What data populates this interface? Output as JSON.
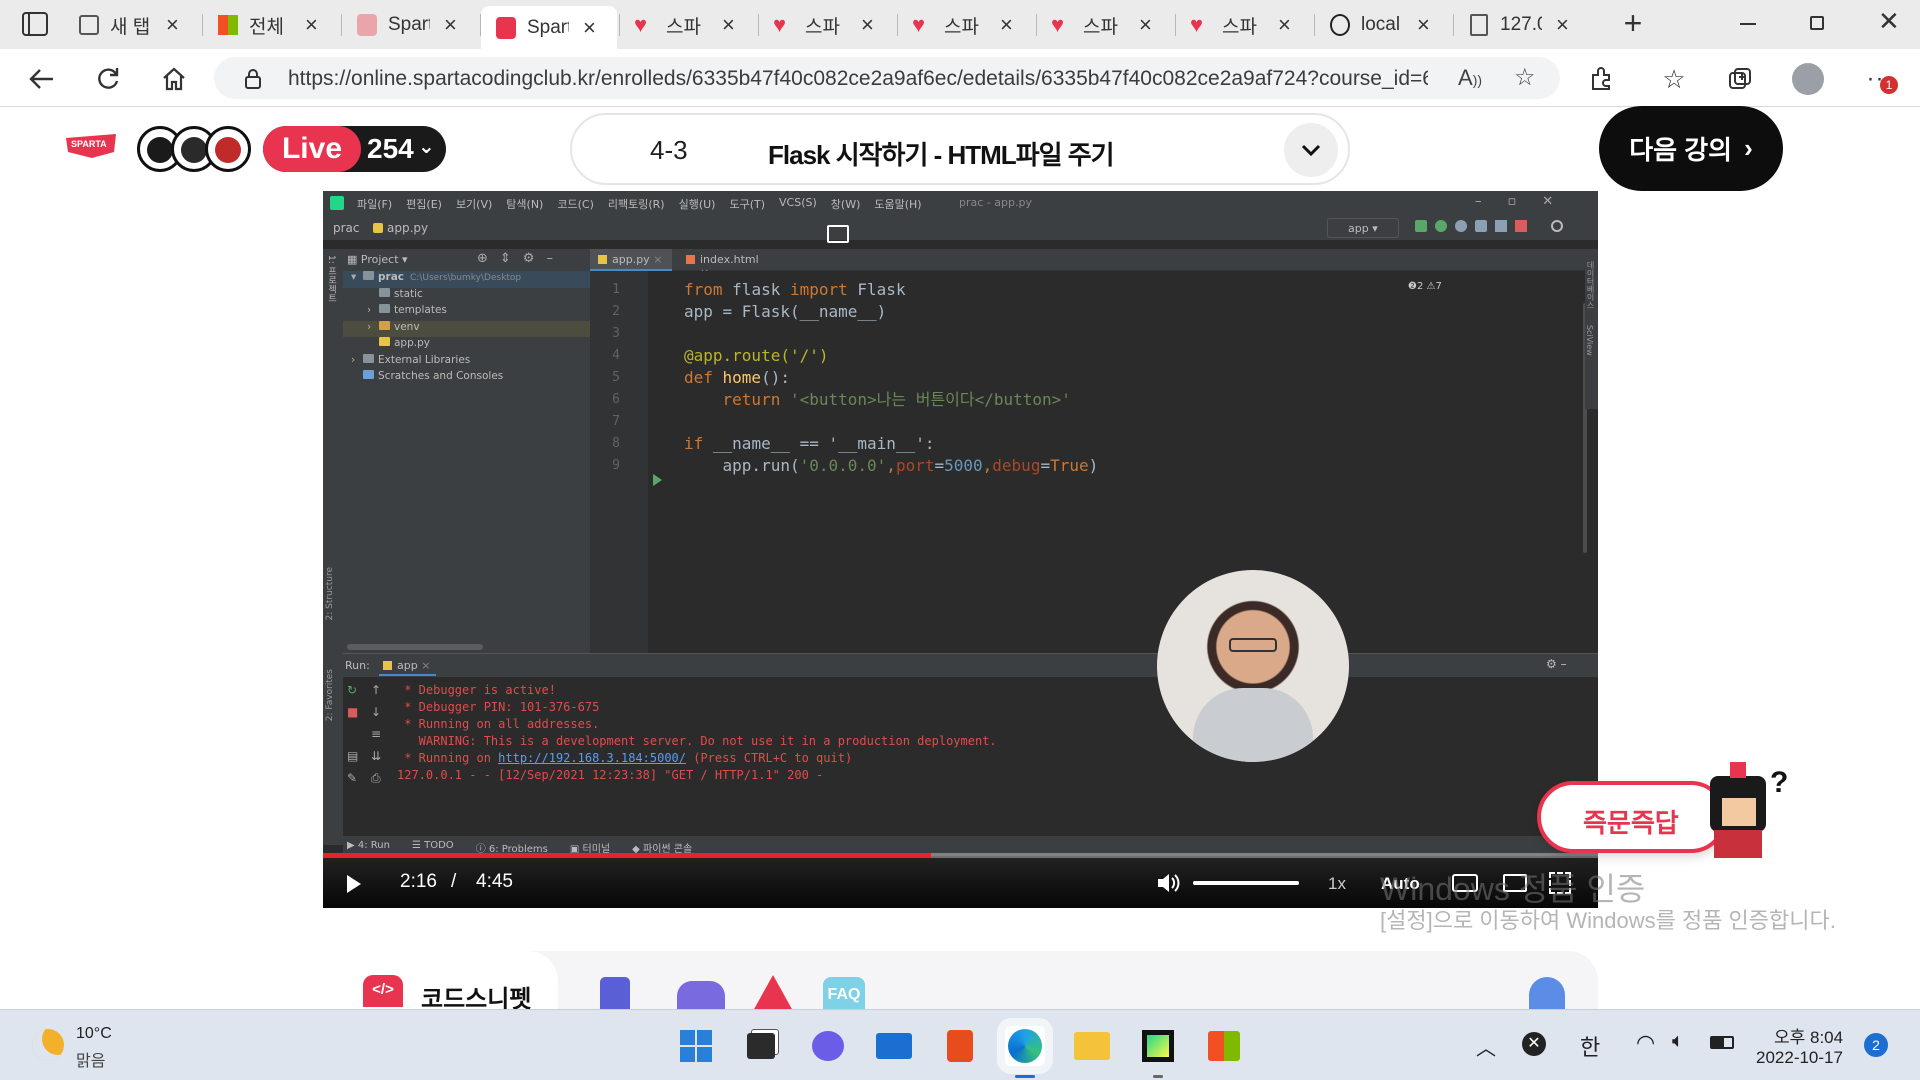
{
  "browser": {
    "tabs": [
      {
        "title": "새 탭",
        "kind": "newtab"
      },
      {
        "title": "전체",
        "kind": "ms"
      },
      {
        "title": "Spart",
        "kind": "sparta-dim"
      },
      {
        "title": "Spart",
        "kind": "sparta",
        "active": true
      },
      {
        "title": "스파",
        "kind": "heart"
      },
      {
        "title": "스파",
        "kind": "heart"
      },
      {
        "title": "스파",
        "kind": "heart"
      },
      {
        "title": "스파",
        "kind": "heart"
      },
      {
        "title": "스파",
        "kind": "heart"
      },
      {
        "title": "local",
        "kind": "local"
      },
      {
        "title": "127.0",
        "kind": "doc"
      }
    ],
    "url": "https://online.spartacodingclub.kr/enrolleds/6335b47f40c082ce2a9af6ec/edetails/6335b47f40c082ce2a9af724?course_id=6...",
    "notification_count": "1"
  },
  "header": {
    "logo": "SPARTA",
    "live_label": "Live",
    "viewer_count": "254",
    "lecture_number": "4-3",
    "lecture_title": "Flask 시작하기 - HTML파일 주기",
    "next_button": "다음 강의"
  },
  "ide": {
    "menu": [
      "파일(F)",
      "편집(E)",
      "보기(V)",
      "탐색(N)",
      "코드(C)",
      "리팩토링(R)",
      "실행(U)",
      "도구(T)",
      "VCS(S)",
      "창(W)",
      "도움말(H)"
    ],
    "window_title": "prac - app.py",
    "breadcrumb": [
      "prac",
      "app.py"
    ],
    "run_config": "app",
    "project_label": "Project",
    "tree": [
      {
        "label": "prac",
        "extra": "C:\\Users\\bumky\\Desktop",
        "level": 0,
        "arrow": "▾",
        "kind": "folder"
      },
      {
        "label": "static",
        "level": 1,
        "arrow": "",
        "kind": "folder"
      },
      {
        "label": "templates",
        "level": 1,
        "arrow": "›",
        "kind": "folder"
      },
      {
        "label": "venv",
        "level": 1,
        "arrow": "›",
        "kind": "folder-orange"
      },
      {
        "label": "app.py",
        "level": 1,
        "arrow": "",
        "kind": "py"
      },
      {
        "label": "External Libraries",
        "level": 0,
        "arrow": "›",
        "kind": "lib"
      },
      {
        "label": "Scratches and Consoles",
        "level": 0,
        "arrow": "",
        "kind": "scratch"
      }
    ],
    "editor_tabs": [
      "app.py",
      "index.html"
    ],
    "inspections": "❷2 ⚠7",
    "line_numbers": [
      "1",
      "2",
      "3",
      "4",
      "5",
      "6",
      "7",
      "8",
      "9"
    ],
    "code": [
      [
        [
          "from ",
          "kw"
        ],
        [
          "flask ",
          "id"
        ],
        [
          "import ",
          "kw"
        ],
        [
          "Flask",
          "id"
        ]
      ],
      [
        [
          "app = Flask(__name__)",
          "id"
        ]
      ],
      [],
      [
        [
          "@app.route('/')",
          "dec"
        ]
      ],
      [
        [
          "def ",
          "kw"
        ],
        [
          "home",
          "fn"
        ],
        [
          "():",
          "id"
        ]
      ],
      [
        [
          "    ",
          "id"
        ],
        [
          "return ",
          "kw"
        ],
        [
          "'<button>나는 버튼이다</button>'",
          "str"
        ]
      ],
      [],
      [
        [
          "if ",
          "kw"
        ],
        [
          "__name__ == '__main__':",
          "id"
        ]
      ],
      [
        [
          "    app.run(",
          "id"
        ],
        [
          "'0.0.0.0'",
          "str"
        ],
        [
          ",",
          "kw"
        ],
        [
          "port",
          "param"
        ],
        [
          "=",
          "id"
        ],
        [
          "5000",
          "num"
        ],
        [
          ",",
          "kw"
        ],
        [
          "debug",
          "param"
        ],
        [
          "=",
          "id"
        ],
        [
          "True",
          "kw"
        ],
        [
          ")",
          "id"
        ]
      ]
    ],
    "run_label": "Run:",
    "run_tab": "app",
    "console": [
      {
        "text": " * Debugger is active!",
        "color": "#e34b4b"
      },
      {
        "text": " * Debugger PIN: 101-376-675",
        "color": "#e34b4b"
      },
      {
        "text": " * Running on all addresses.",
        "color": "#e34b4b"
      },
      {
        "text": "   WARNING: This is a development server. Do not use it in a production deployment.",
        "color": "#e34b4b"
      },
      {
        "text": " * Running on ",
        "color": "#e34b4b",
        "link": "http://192.168.3.184:5000/",
        "after": " (Press CTRL+C to quit)"
      },
      {
        "text": "127.0.0.1 - - [12/Sep/2021 12:23:38] \"GET / HTTP/1.1\" 200 -",
        "color": "#e34b4b"
      }
    ],
    "bottom_tools": [
      "4: Run",
      "TODO",
      "6: Problems",
      "터미널",
      "파이썬 콘솔"
    ],
    "side_labels": {
      "project": "1: 프로젝트",
      "structure": "2: Structure",
      "favorites": "2: Favorites",
      "right": "데이터베이스",
      "sciview": "SciView"
    }
  },
  "player": {
    "current": "2:16",
    "separator": "/",
    "duration": "4:45",
    "speed": "1x",
    "quality": "Auto",
    "progress_fraction": 0.477,
    "volume_fraction": 1.0
  },
  "overlay": {
    "quick_answer": "즉문즉답",
    "watermark_title": "Windows 정품 인증",
    "watermark_text": "[설정]으로 이동하여 Windows를 정품 인증합니다."
  },
  "bottom_tabs": {
    "first": "코드스니펫",
    "faq": "FAQ"
  },
  "taskbar": {
    "temperature": "10°C",
    "weather": "맑음",
    "ime": "한",
    "ampm_time": "오후 8:04",
    "date": "2022-10-17",
    "notifications": "2"
  },
  "colors": {
    "brand_red": "#e8344e",
    "live_red": "#e8344e",
    "ide_bg": "#2b2b2b",
    "progress_red": "#e5242e"
  }
}
